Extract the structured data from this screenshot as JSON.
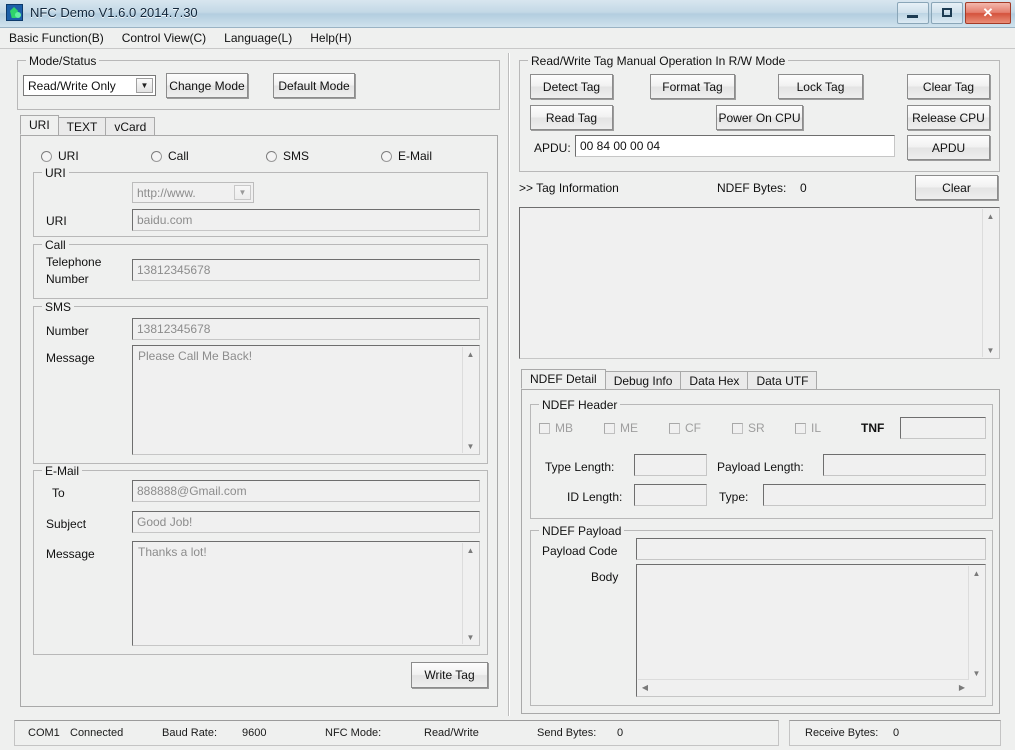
{
  "window": {
    "title": "NFC Demo V1.6.0 2014.7.30",
    "icon": "app-icon",
    "minimize_label": "minimize-icon",
    "maximize_label": "maximize-icon",
    "close_label": "✕"
  },
  "menu": {
    "items": [
      {
        "label": "Basic Function(B)"
      },
      {
        "label": "Control View(C)"
      },
      {
        "label": "Language(L)"
      },
      {
        "label": "Help(H)"
      }
    ]
  },
  "mode_status": {
    "legend": "Mode/Status",
    "mode_value": "Read/Write Only",
    "change_mode_label": "Change Mode",
    "default_mode_label": "Default Mode"
  },
  "left_tabs": {
    "items": [
      {
        "label": "URI",
        "selected": true
      },
      {
        "label": "TEXT",
        "selected": false
      },
      {
        "label": "vCard",
        "selected": false
      }
    ]
  },
  "record_types": {
    "options": [
      {
        "label": "URI",
        "checked": false
      },
      {
        "label": "Call",
        "checked": false
      },
      {
        "label": "SMS",
        "checked": false
      },
      {
        "label": "E-Mail",
        "checked": false
      }
    ]
  },
  "uri_group": {
    "legend": "URI",
    "scheme_value": "http://www.",
    "uri_label": "URI",
    "uri_value": "baidu.com"
  },
  "call_group": {
    "legend": "Call",
    "telephone_label_line1": "Telephone",
    "telephone_label_line2": "Number",
    "telephone_value": "13812345678"
  },
  "sms_group": {
    "legend": "SMS",
    "number_label": "Number",
    "number_value": "13812345678",
    "message_label": "Message",
    "message_value": "Please Call Me Back!"
  },
  "email_group": {
    "legend": "E-Mail",
    "to_label": "To",
    "to_value": "888888@Gmail.com",
    "subject_label": "Subject",
    "subject_value": "Good Job!",
    "message_label": "Message",
    "message_value": "Thanks a lot!"
  },
  "write_tag": {
    "label": "Write Tag"
  },
  "manual_ops": {
    "legend": "Read/Write Tag Manual Operation In R/W Mode",
    "buttons": [
      {
        "label": "Detect Tag"
      },
      {
        "label": "Format Tag"
      },
      {
        "label": "Lock Tag"
      },
      {
        "label": "Clear Tag"
      },
      {
        "label": "Read Tag"
      },
      {
        "label": "Power On CPU"
      },
      {
        "label": "Release CPU"
      }
    ],
    "apdu_label": "APDU:",
    "apdu_value": "00 84 00 00 04",
    "apdu_button_label": "APDU"
  },
  "tag_info": {
    "header": ">> Tag Information",
    "ndef_bytes_label": "NDEF Bytes:",
    "ndef_bytes_value": "0",
    "clear_label": "Clear",
    "content": ""
  },
  "right_tabs": {
    "items": [
      {
        "label": "NDEF Detail",
        "selected": true
      },
      {
        "label": "Debug Info",
        "selected": false
      },
      {
        "label": "Data Hex",
        "selected": false
      },
      {
        "label": "Data UTF",
        "selected": false
      }
    ]
  },
  "ndef_header": {
    "legend": "NDEF Header",
    "flags": [
      {
        "label": "MB",
        "checked": false
      },
      {
        "label": "ME",
        "checked": false
      },
      {
        "label": "CF",
        "checked": false
      },
      {
        "label": "SR",
        "checked": false
      },
      {
        "label": "IL",
        "checked": false
      }
    ],
    "tnf_label": "TNF",
    "tnf_value": "",
    "type_length_label": "Type Length:",
    "type_length_value": "",
    "payload_length_label": "Payload Length:",
    "payload_length_value": "",
    "id_length_label": "ID Length:",
    "id_length_value": "",
    "type_label": "Type:",
    "type_value": ""
  },
  "ndef_payload": {
    "legend": "NDEF Payload",
    "payload_code_label": "Payload Code",
    "payload_code_value": "",
    "body_label": "Body",
    "body_value": ""
  },
  "statusbar": {
    "com_port": "COM1",
    "connection": "Connected",
    "baud_rate_label": "Baud Rate:",
    "baud_rate_value": "9600",
    "nfc_mode_label": "NFC Mode:",
    "nfc_mode_value": "Read/Write",
    "send_bytes_label": "Send Bytes:",
    "send_bytes_value": "0",
    "receive_bytes_label": "Receive Bytes:",
    "receive_bytes_value": "0"
  },
  "colors": {
    "titlebar_accent": "#b3cddf",
    "close_button": "#d4523c",
    "window_bg": "#eff0ef",
    "field_bg": "#f0f0f0",
    "placeholder_text": "#8c8c8c"
  }
}
